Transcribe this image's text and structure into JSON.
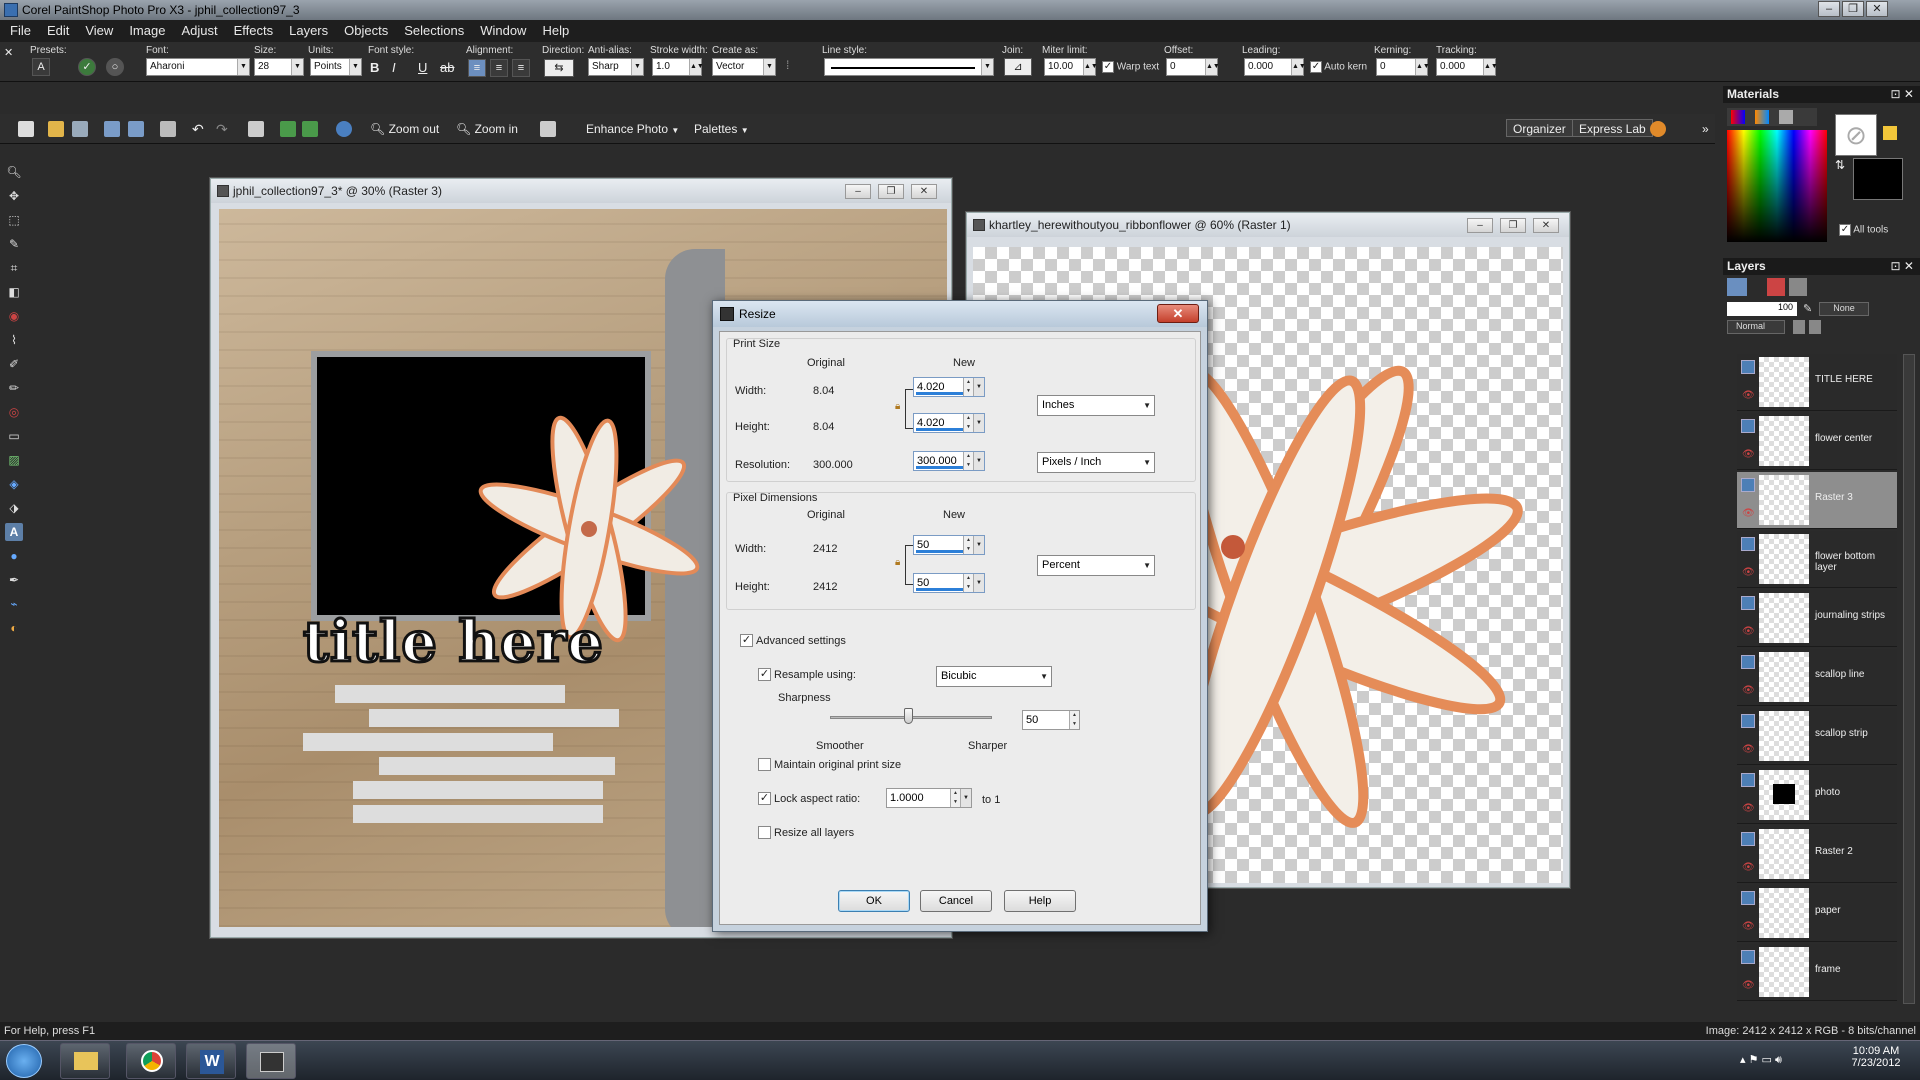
{
  "window": {
    "title": "Corel PaintShop Photo Pro X3 - jphil_collection97_3"
  },
  "menu": [
    "File",
    "Edit",
    "View",
    "Image",
    "Adjust",
    "Effects",
    "Layers",
    "Objects",
    "Selections",
    "Window",
    "Help"
  ],
  "tool_options": {
    "presets_label": "Presets:",
    "font_label": "Font:",
    "font_value": "Aharoni",
    "size_label": "Size:",
    "size_value": "28",
    "units_label": "Units:",
    "units_value": "Points",
    "font_style_label": "Font style:",
    "alignment_label": "Alignment:",
    "direction_label": "Direction:",
    "antialias_label": "Anti-alias:",
    "antialias_value": "Sharp",
    "stroke_label": "Stroke width:",
    "stroke_value": "1.0",
    "create_as_label": "Create as:",
    "create_as_value": "Vector",
    "line_style_label": "Line style:",
    "join_label": "Join:",
    "miter_label": "Miter limit:",
    "miter_value": "10.00",
    "warp_text": "Warp text",
    "offset_label": "Offset:",
    "offset_value": "0",
    "leading_label": "Leading:",
    "leading_value": "0.000",
    "auto_kern": "Auto kern",
    "kerning_label": "Kerning:",
    "kerning_value": "0",
    "tracking_label": "Tracking:",
    "tracking_value": "0.000"
  },
  "standard_toolbar": {
    "zoom_out": "Zoom out",
    "zoom_in": "Zoom in",
    "enhance_photo": "Enhance Photo",
    "palettes": "Palettes",
    "organizer": "Organizer",
    "express_lab": "Express Lab"
  },
  "doc1": {
    "title": "jphil_collection97_3* @  30% (Raster 3)",
    "title_text": "title here"
  },
  "doc2": {
    "title": "khartley_herewithoutyou_ribbonflower @  60% (Raster 1)"
  },
  "dialog": {
    "title": "Resize",
    "print_size": "Print Size",
    "original": "Original",
    "new": "New",
    "width_label": "Width:",
    "height_label": "Height:",
    "resolution_label": "Resolution:",
    "print_width_orig": "8.04",
    "print_height_orig": "8.04",
    "resolution_orig": "300.000",
    "print_width_new": "4.020",
    "print_height_new": "4.020",
    "resolution_new": "300.000",
    "print_unit": "Inches",
    "resolution_unit": "Pixels / Inch",
    "pixel_dimensions": "Pixel Dimensions",
    "pixel_width_orig": "2412",
    "pixel_height_orig": "2412",
    "pixel_width_new": "50",
    "pixel_height_new": "50",
    "pixel_unit": "Percent",
    "advanced_settings": "Advanced settings",
    "resample_using": "Resample using:",
    "resample_method": "Bicubic",
    "sharpness": "Sharpness",
    "smoother": "Smoother",
    "sharper": "Sharper",
    "sharpness_value": "50",
    "maintain_print": "Maintain original print size",
    "lock_aspect": "Lock aspect ratio:",
    "aspect_value": "1.0000",
    "to_1": "to 1",
    "resize_all": "Resize all layers",
    "ok": "OK",
    "cancel": "Cancel",
    "help": "Help"
  },
  "materials": {
    "title": "Materials",
    "all_tools": "All tools"
  },
  "layers": {
    "title": "Layers",
    "opacity": "100",
    "blend_mode": "Normal",
    "mask": "None",
    "items": [
      "TITLE HERE",
      "flower center",
      "Raster 3",
      "flower bottom layer",
      "journaling strips",
      "scallop line",
      "scallop strip",
      "photo",
      "Raster 2",
      "paper",
      "frame"
    ]
  },
  "status": {
    "help": "For Help, press F1",
    "image_info": "Image:  2412 x 2412 x RGB - 8 bits/channel"
  },
  "taskbar": {
    "time": "10:09 AM",
    "date": "7/23/2012"
  }
}
